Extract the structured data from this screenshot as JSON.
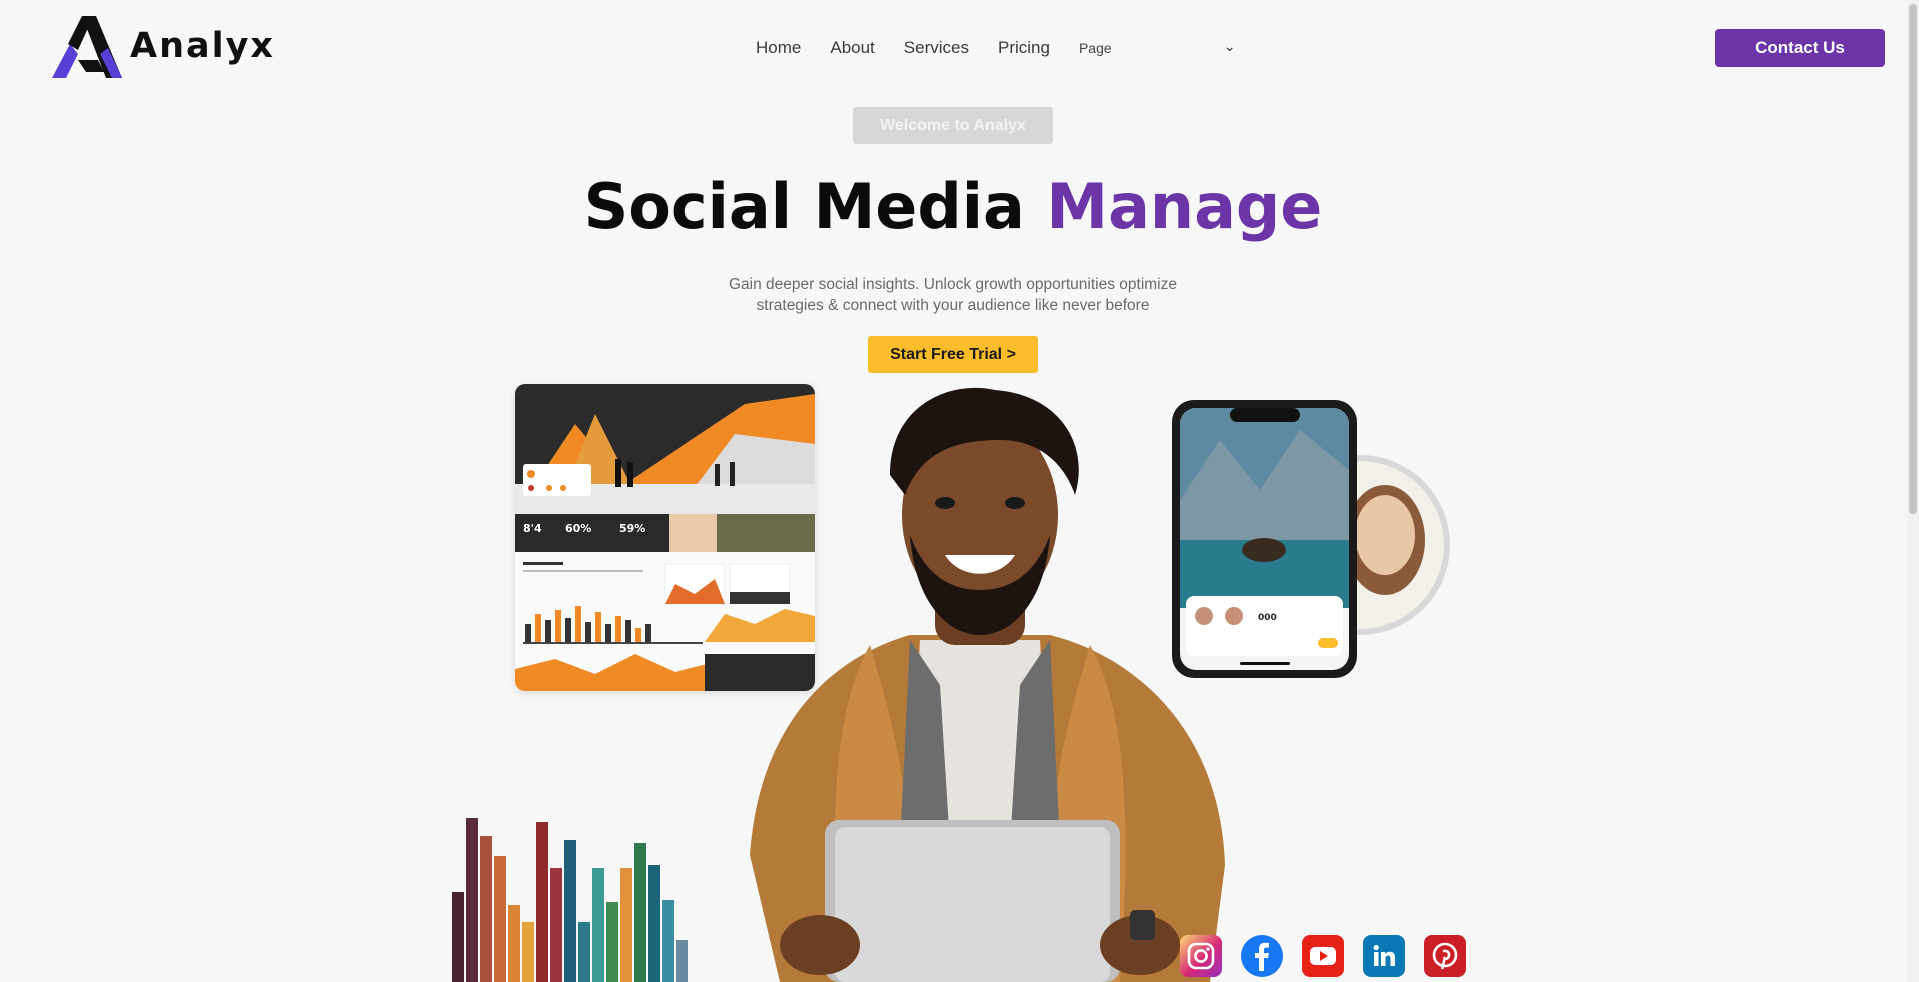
{
  "brand": {
    "name": "Analyx",
    "accent": "#6b35a8",
    "cta": "#fbbd2c"
  },
  "nav": {
    "items": [
      {
        "label": "Home"
      },
      {
        "label": "About"
      },
      {
        "label": "Services"
      },
      {
        "label": "Pricing"
      }
    ],
    "page_label": "Page"
  },
  "header": {
    "contact_label": "Contact Us"
  },
  "hero": {
    "badge": "Welcome to Analyx",
    "title_main": "Social Media ",
    "title_accent": "Manage",
    "subtitle": "Gain deeper social insights. Unlock growth opportunities optimize strategies & connect with your audience like never before",
    "cta_label": "Start Free Trial >"
  },
  "dashboard": {
    "stats": [
      "8'4",
      "60%",
      "59%"
    ]
  },
  "phone": {
    "card_value": "000"
  },
  "social": [
    {
      "name": "instagram-icon"
    },
    {
      "name": "facebook-icon"
    },
    {
      "name": "youtube-icon"
    },
    {
      "name": "linkedin-icon"
    },
    {
      "name": "pinterest-icon"
    }
  ]
}
